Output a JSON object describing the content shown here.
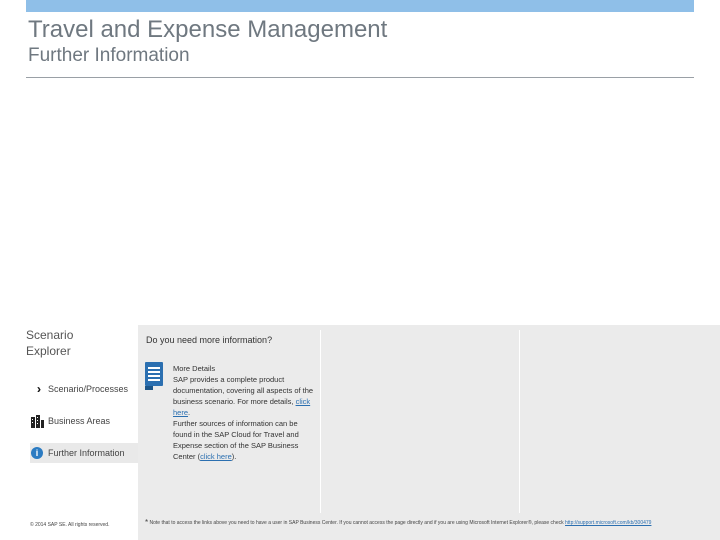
{
  "header": {
    "title": "Travel and Expense Management",
    "subtitle": "Further Information",
    "accent_color": "#8fbfe8"
  },
  "sidebar": {
    "title": "Scenario Explorer",
    "items": [
      {
        "label": "Scenario/Processes",
        "icon": "chevron-double-icon"
      },
      {
        "label": "Business Areas",
        "icon": "buildings-icon"
      },
      {
        "label": "Further Information",
        "icon": "info-icon",
        "active": true
      }
    ],
    "copyright": "© 2014 SAP SE. All rights reserved."
  },
  "content": {
    "question": "Do you need more information?",
    "details_heading": "More Details",
    "details_text_1": "SAP provides a complete product documentation, covering all aspects of the business scenario. For more details,",
    "details_link_1": "click here",
    "details_after_1": ".",
    "details_text_2": "Further sources of information can be found in the SAP Cloud for Travel and Expense section of the SAP Business Center (",
    "details_link_2": "click here",
    "details_after_2": ").",
    "doc_icon_color": "#2b6fb0"
  },
  "footnote": {
    "marker": "*",
    "text": "Note that to access the links above you need to have a user in SAP Business Center. If you cannot access the page directly and if you are using Microsoft Internet Explorer®, please check",
    "link": "http://support.microsoft.com/kb/300479"
  }
}
